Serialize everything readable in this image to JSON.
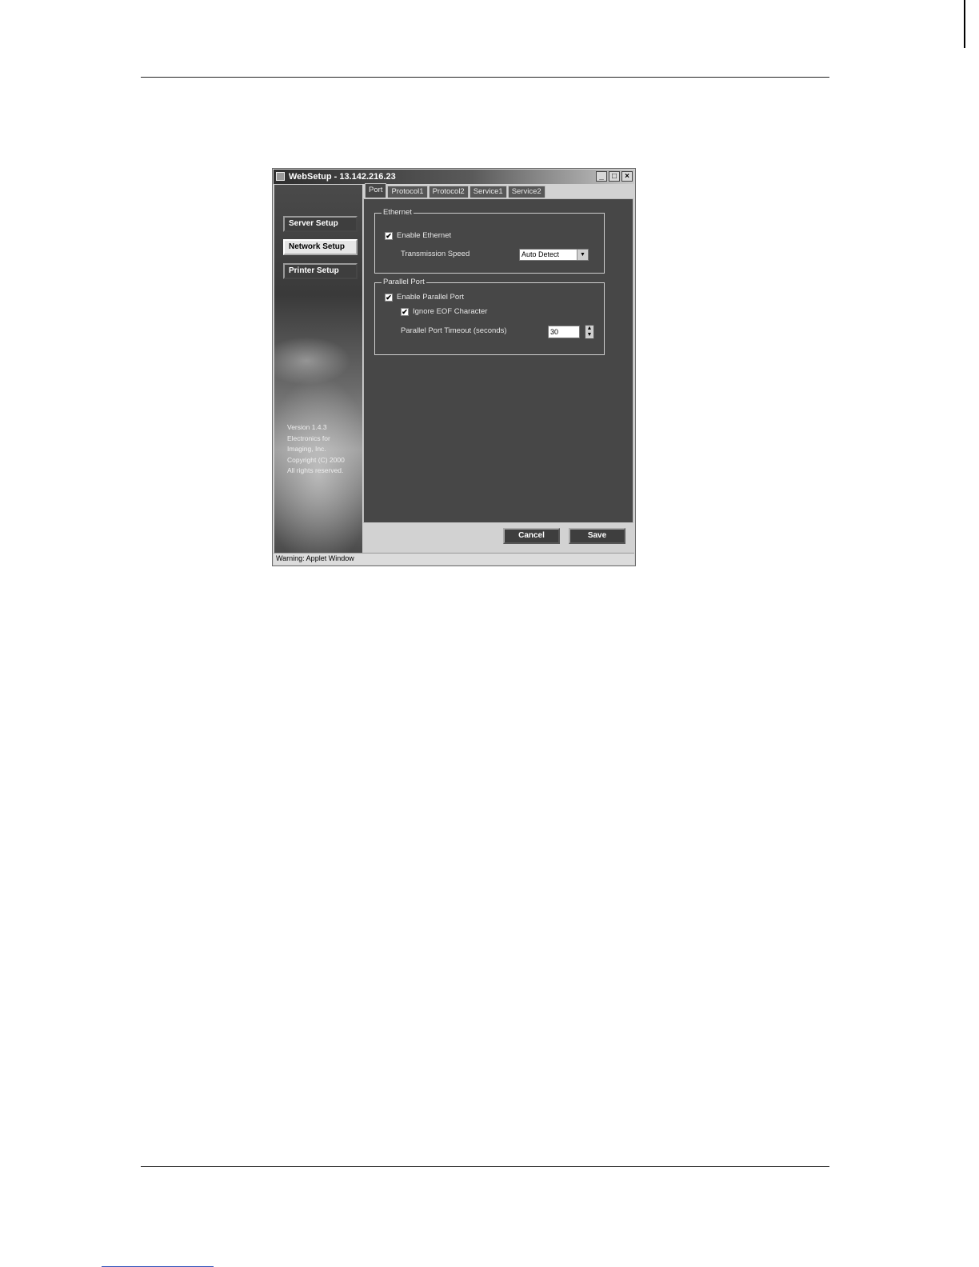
{
  "window": {
    "title": "WebSetup - 13.142.216.23",
    "minimize": "_",
    "maximize": "□",
    "close": "×"
  },
  "nav": {
    "server_setup": "Server Setup",
    "network_setup": "Network Setup",
    "printer_setup": "Printer Setup",
    "active": "network_setup"
  },
  "version_lines": [
    "Version 1.4.3",
    "Electronics for",
    "Imaging, Inc.",
    "Copyright (C) 2000",
    "All rights reserved."
  ],
  "tabs": [
    "Port",
    "Protocol1",
    "Protocol2",
    "Service1",
    "Service2"
  ],
  "active_tab": "Port",
  "ethernet": {
    "group_label": "Ethernet",
    "enable_label": "Enable Ethernet",
    "enable_checked": true,
    "speed_label": "Transmission Speed",
    "speed_value": "Auto Detect"
  },
  "parallel": {
    "group_label": "Parallel Port",
    "enable_label": "Enable Parallel Port",
    "enable_checked": true,
    "ignore_eof_label": "Ignore EOF Character",
    "ignore_eof_checked": true,
    "timeout_label": "Parallel Port Timeout (seconds)",
    "timeout_value": "30"
  },
  "buttons": {
    "cancel": "Cancel",
    "save": "Save"
  },
  "status": "Warning: Applet Window",
  "icons": {
    "checkmark": "✔",
    "dropdown": "▼",
    "spin_up": "▲",
    "spin_down": "▼"
  }
}
